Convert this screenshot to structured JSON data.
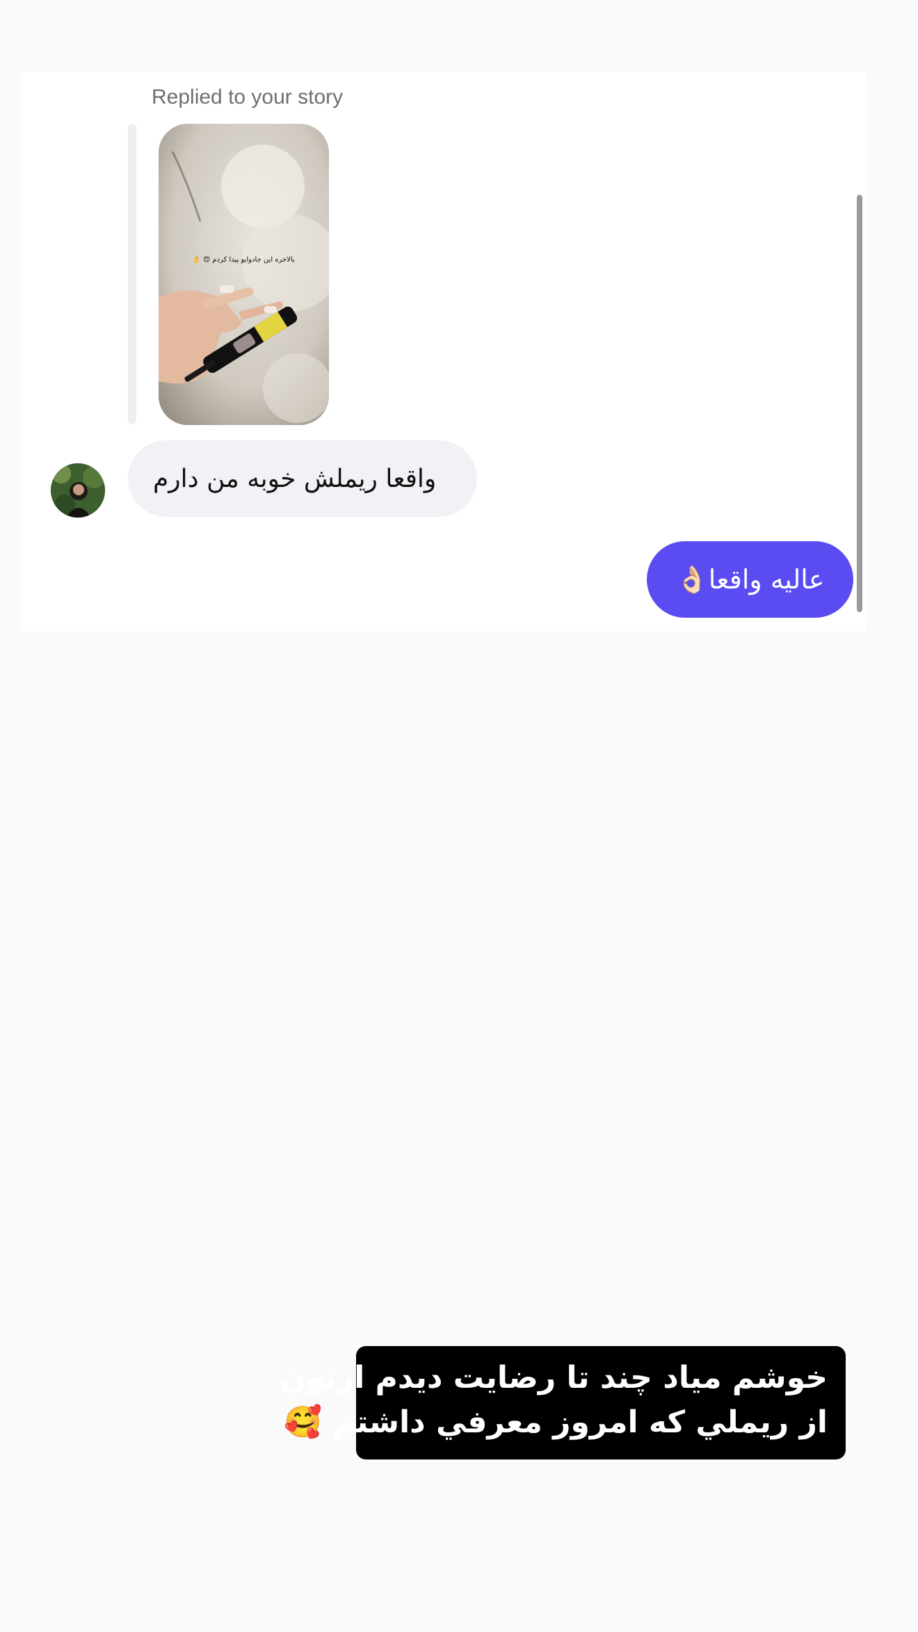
{
  "story_reply": {
    "label": "Replied to your story",
    "story_overlay_text": "بالاخره این جادوایو پیدا کردم 😍 👌"
  },
  "messages": {
    "incoming": "واقعا ریملش خوبه من دارم",
    "outgoing": "عالیه واقعا👌🏻"
  },
  "caption": {
    "line1": "خوشم مياد چند تا رضايت ديدم ازتون",
    "line2": "از ريملي كه امروز معرفي داشتم 🥰"
  },
  "colors": {
    "outgoing_bubble": "#5b4cf2",
    "incoming_bubble": "#f1f2f5",
    "caption_background": "#000000"
  }
}
